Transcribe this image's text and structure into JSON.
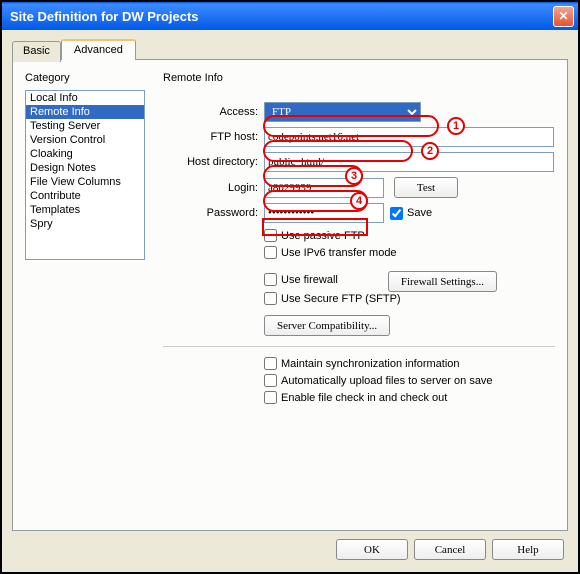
{
  "window": {
    "title": "Site Definition for DW Projects"
  },
  "tabs": {
    "basic": "Basic",
    "advanced": "Advanced"
  },
  "category": {
    "label": "Category",
    "items": [
      "Local Info",
      "Remote Info",
      "Testing Server",
      "Version Control",
      "Cloaking",
      "Design Notes",
      "File View Columns",
      "Contribute",
      "Templates",
      "Spry"
    ],
    "selected": "Remote Info"
  },
  "section": {
    "title": "Remote Info"
  },
  "form": {
    "access": {
      "label": "Access:",
      "value": "FTP"
    },
    "ftp_host": {
      "label": "FTP host:",
      "value": "codepoints.net16.net"
    },
    "host_dir": {
      "label": "Host directory:",
      "value": "public_html/"
    },
    "login": {
      "label": "Login:",
      "value": "a8029939",
      "test": "Test"
    },
    "password": {
      "label": "Password:",
      "value": "••••••••••••",
      "save_label": "Save",
      "save_checked": true
    },
    "passive": {
      "label": "Use passive FTP"
    },
    "ipv6": {
      "label": "Use IPv6 transfer mode"
    },
    "firewall": {
      "label": "Use firewall",
      "settings": "Firewall Settings..."
    },
    "sftp": {
      "label": "Use Secure FTP (SFTP)"
    },
    "compat": "Server Compatibility...",
    "sync": {
      "label": "Maintain synchronization information"
    },
    "auto_upload": {
      "label": "Automatically upload files to server on save"
    },
    "checkin": {
      "label": "Enable file check in and check out"
    }
  },
  "buttons": {
    "ok": "OK",
    "cancel": "Cancel",
    "help": "Help"
  },
  "annotations": {
    "n1": "1",
    "n2": "2",
    "n3": "3",
    "n4": "4"
  }
}
